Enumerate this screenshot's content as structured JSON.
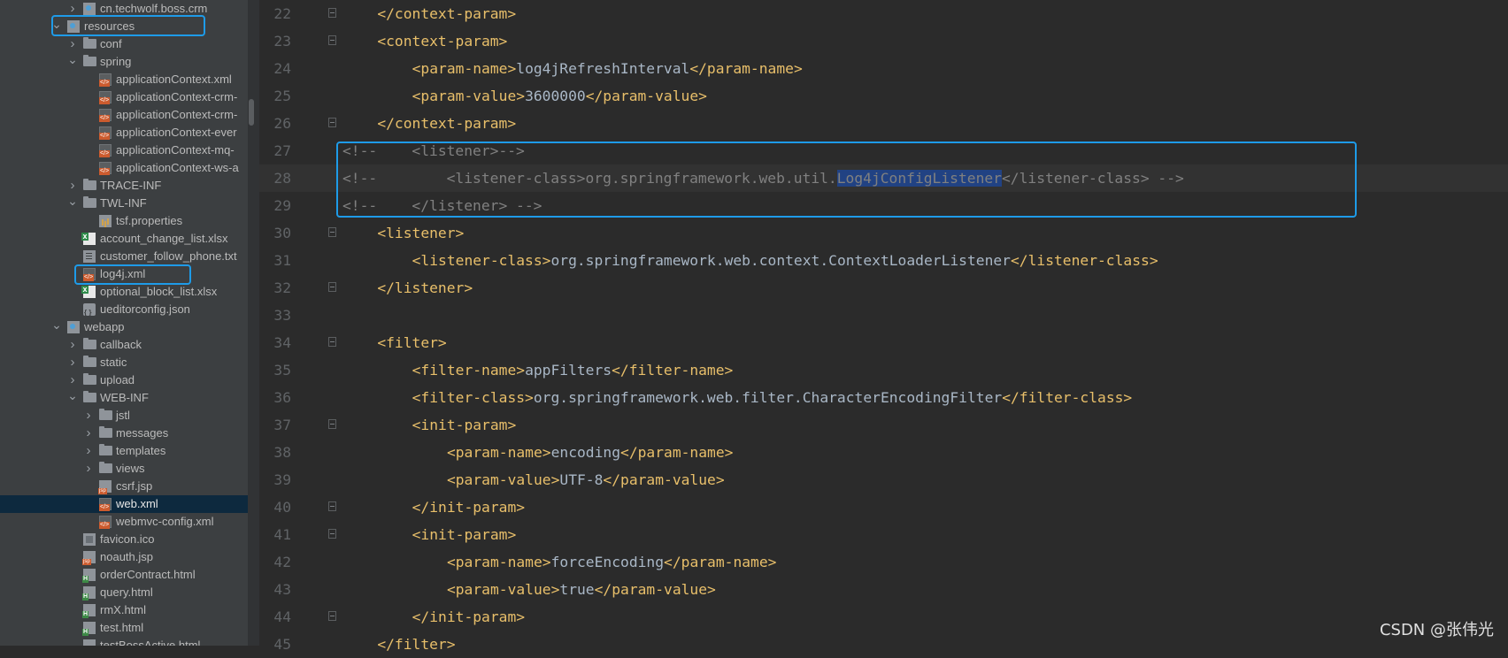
{
  "project_tree": {
    "items": [
      {
        "label": "cn.techwolf.boss.crm",
        "icon": "package-folder-icon",
        "expanded": false,
        "depth": 3
      },
      {
        "label": "resources",
        "icon": "resources-folder-icon",
        "expanded": true,
        "depth": 2,
        "boxed": true
      },
      {
        "label": "conf",
        "icon": "folder-icon",
        "expanded": false,
        "depth": 3
      },
      {
        "label": "spring",
        "icon": "folder-icon",
        "expanded": true,
        "depth": 3
      },
      {
        "label": "applicationContext.xml",
        "icon": "xml-file-icon",
        "depth": 4
      },
      {
        "label": "applicationContext-crm-",
        "icon": "xml-file-icon",
        "depth": 4
      },
      {
        "label": "applicationContext-crm-",
        "icon": "xml-file-icon",
        "depth": 4
      },
      {
        "label": "applicationContext-ever",
        "icon": "xml-file-icon",
        "depth": 4
      },
      {
        "label": "applicationContext-mq-",
        "icon": "xml-file-icon",
        "depth": 4
      },
      {
        "label": "applicationContext-ws-a",
        "icon": "xml-file-icon",
        "depth": 4
      },
      {
        "label": "TRACE-INF",
        "icon": "folder-icon",
        "expanded": false,
        "depth": 3
      },
      {
        "label": "TWL-INF",
        "icon": "folder-icon",
        "expanded": true,
        "depth": 3
      },
      {
        "label": "tsf.properties",
        "icon": "properties-file-icon",
        "depth": 4
      },
      {
        "label": "account_change_list.xlsx",
        "icon": "excel-file-icon",
        "depth": 3
      },
      {
        "label": "customer_follow_phone.txt",
        "icon": "text-file-icon",
        "depth": 3
      },
      {
        "label": "log4j.xml",
        "icon": "xml-file-icon",
        "depth": 3,
        "boxed": true
      },
      {
        "label": "optional_block_list.xlsx",
        "icon": "excel-file-icon",
        "depth": 3
      },
      {
        "label": "ueditorconfig.json",
        "icon": "json-file-icon",
        "depth": 3
      },
      {
        "label": "webapp",
        "icon": "web-folder-icon",
        "expanded": true,
        "depth": 2
      },
      {
        "label": "callback",
        "icon": "folder-icon",
        "expanded": false,
        "depth": 3
      },
      {
        "label": "static",
        "icon": "folder-icon",
        "expanded": false,
        "depth": 3
      },
      {
        "label": "upload",
        "icon": "folder-icon",
        "expanded": false,
        "depth": 3
      },
      {
        "label": "WEB-INF",
        "icon": "folder-icon",
        "expanded": true,
        "depth": 3
      },
      {
        "label": "jstl",
        "icon": "folder-icon",
        "expanded": false,
        "depth": 4
      },
      {
        "label": "messages",
        "icon": "folder-icon",
        "expanded": false,
        "depth": 4
      },
      {
        "label": "templates",
        "icon": "folder-icon",
        "expanded": false,
        "depth": 4
      },
      {
        "label": "views",
        "icon": "folder-icon",
        "expanded": false,
        "depth": 4
      },
      {
        "label": "csrf.jsp",
        "icon": "jsp-file-icon",
        "depth": 4
      },
      {
        "label": "web.xml",
        "icon": "xml-file-icon",
        "depth": 4,
        "selected": true
      },
      {
        "label": "webmvc-config.xml",
        "icon": "xml-file-icon",
        "depth": 4
      },
      {
        "label": "favicon.ico",
        "icon": "ico-file-icon",
        "depth": 3
      },
      {
        "label": "noauth.jsp",
        "icon": "jsp-file-icon",
        "depth": 3
      },
      {
        "label": "orderContract.html",
        "icon": "html-file-icon",
        "depth": 3
      },
      {
        "label": "query.html",
        "icon": "html-file-icon",
        "depth": 3
      },
      {
        "label": "rmX.html",
        "icon": "html-file-icon",
        "depth": 3
      },
      {
        "label": "test.html",
        "icon": "html-file-icon",
        "depth": 3
      },
      {
        "label": "testBossActive.html",
        "icon": "html-file-icon",
        "depth": 3
      }
    ]
  },
  "editor": {
    "lines": [
      {
        "num": "22",
        "fold": true,
        "indent": 1,
        "segments": [
          [
            "tag",
            "</context-param>"
          ]
        ]
      },
      {
        "num": "23",
        "fold": true,
        "indent": 1,
        "segments": [
          [
            "tag",
            "<context-param>"
          ]
        ]
      },
      {
        "num": "24",
        "indent": 2,
        "segments": [
          [
            "tag",
            "<param-name>"
          ],
          [
            "txt",
            "log4jRefreshInterval"
          ],
          [
            "tag",
            "</param-name>"
          ]
        ]
      },
      {
        "num": "25",
        "indent": 2,
        "segments": [
          [
            "tag",
            "<param-value>"
          ],
          [
            "txt",
            "3600000"
          ],
          [
            "tag",
            "</param-value>"
          ]
        ]
      },
      {
        "num": "26",
        "fold": true,
        "indent": 1,
        "segments": [
          [
            "tag",
            "</context-param>"
          ]
        ]
      },
      {
        "num": "27",
        "indent": 0,
        "segments": [
          [
            "cmt",
            "<!--    <listener>-->"
          ]
        ]
      },
      {
        "num": "28",
        "indent": 0,
        "current": true,
        "segments": [
          [
            "cmt",
            "<!--        <listener-class>org.springframework.web.util."
          ],
          [
            "hl",
            "Log4jConfigListener"
          ],
          [
            "cmt",
            "</listener-class> -->"
          ]
        ]
      },
      {
        "num": "29",
        "indent": 0,
        "segments": [
          [
            "cmt",
            "<!--    </listener> -->"
          ]
        ]
      },
      {
        "num": "30",
        "fold": true,
        "indent": 1,
        "segments": [
          [
            "tag",
            "<listener>"
          ]
        ]
      },
      {
        "num": "31",
        "indent": 2,
        "segments": [
          [
            "tag",
            "<listener-class>"
          ],
          [
            "txt",
            "org.springframework.web.context.ContextLoaderListener"
          ],
          [
            "tag",
            "</listener-class>"
          ]
        ]
      },
      {
        "num": "32",
        "fold": true,
        "indent": 1,
        "segments": [
          [
            "tag",
            "</listener>"
          ]
        ]
      },
      {
        "num": "33",
        "indent": 0,
        "segments": []
      },
      {
        "num": "34",
        "fold": true,
        "indent": 1,
        "segments": [
          [
            "tag",
            "<filter>"
          ]
        ]
      },
      {
        "num": "35",
        "indent": 2,
        "segments": [
          [
            "tag",
            "<filter-name>"
          ],
          [
            "txt",
            "appFilters"
          ],
          [
            "tag",
            "</filter-name>"
          ]
        ]
      },
      {
        "num": "36",
        "indent": 2,
        "segments": [
          [
            "tag",
            "<filter-class>"
          ],
          [
            "txt",
            "org.springframework.web.filter.CharacterEncodingFilter"
          ],
          [
            "tag",
            "</filter-class>"
          ]
        ]
      },
      {
        "num": "37",
        "fold": true,
        "indent": 2,
        "segments": [
          [
            "tag",
            "<init-param>"
          ]
        ]
      },
      {
        "num": "38",
        "indent": 3,
        "segments": [
          [
            "tag",
            "<param-name>"
          ],
          [
            "txt",
            "encoding"
          ],
          [
            "tag",
            "</param-name>"
          ]
        ]
      },
      {
        "num": "39",
        "indent": 3,
        "segments": [
          [
            "tag",
            "<param-value>"
          ],
          [
            "txt",
            "UTF-8"
          ],
          [
            "tag",
            "</param-value>"
          ]
        ]
      },
      {
        "num": "40",
        "fold": true,
        "indent": 2,
        "segments": [
          [
            "tag",
            "</init-param>"
          ]
        ]
      },
      {
        "num": "41",
        "fold": true,
        "indent": 2,
        "segments": [
          [
            "tag",
            "<init-param>"
          ]
        ]
      },
      {
        "num": "42",
        "indent": 3,
        "segments": [
          [
            "tag",
            "<param-name>"
          ],
          [
            "txt",
            "forceEncoding"
          ],
          [
            "tag",
            "</param-name>"
          ]
        ]
      },
      {
        "num": "43",
        "indent": 3,
        "segments": [
          [
            "tag",
            "<param-value>"
          ],
          [
            "txt",
            "true"
          ],
          [
            "tag",
            "</param-value>"
          ]
        ]
      },
      {
        "num": "44",
        "fold": true,
        "indent": 2,
        "segments": [
          [
            "tag",
            "</init-param>"
          ]
        ]
      },
      {
        "num": "45",
        "indent": 1,
        "segments": [
          [
            "tag",
            "</filter>"
          ]
        ]
      }
    ]
  },
  "watermark": "CSDN @张伟光",
  "colors": {
    "highlight_box": "#1e9be8",
    "tag": "#e8bf6a",
    "text": "#a9b7c6",
    "comment": "#808080",
    "selection": "#214283"
  }
}
